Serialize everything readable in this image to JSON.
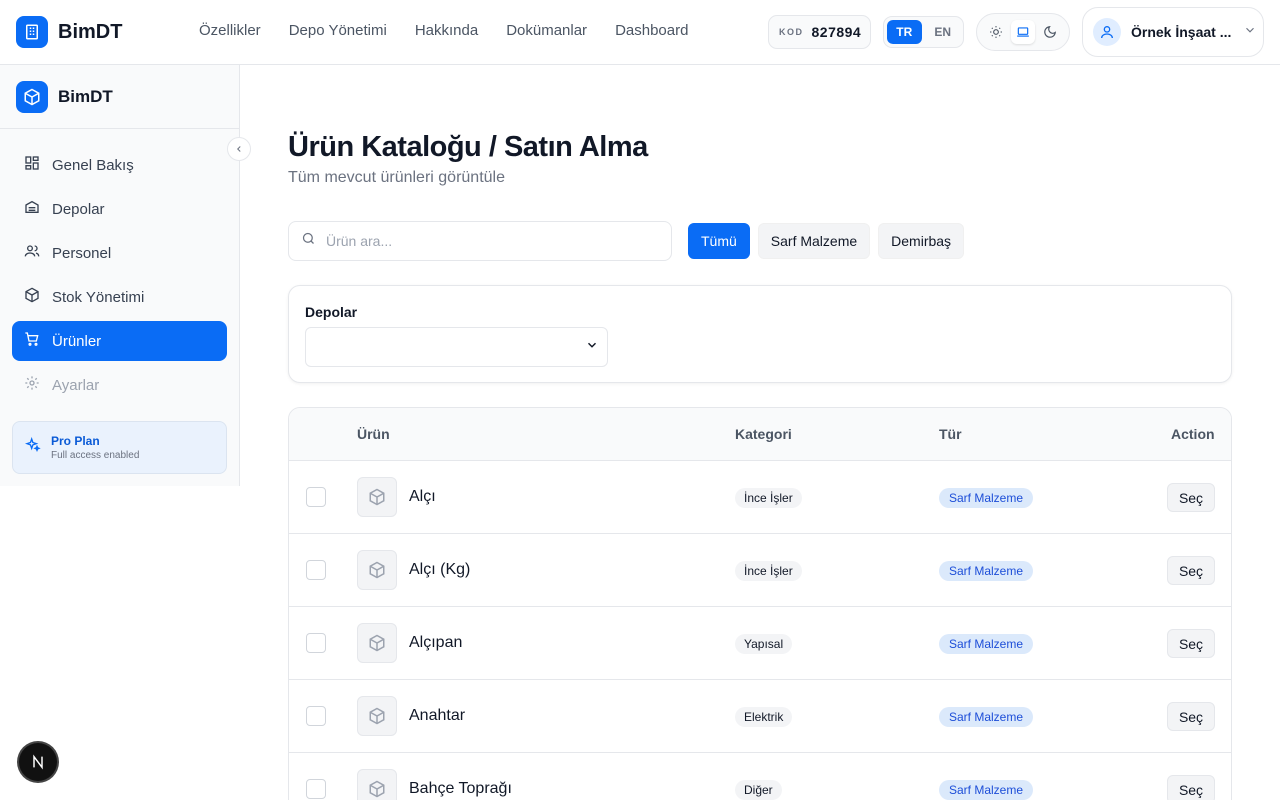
{
  "header": {
    "brand": "BimDT",
    "nav": [
      "Özellikler",
      "Depo Yönetimi",
      "Hakkında",
      "Dokümanlar",
      "Dashboard"
    ],
    "code_label": "KOD",
    "code_value": "827894",
    "lang": {
      "tr": "TR",
      "en": "EN",
      "active": "TR"
    },
    "theme_icons": [
      "sun-icon",
      "laptop-icon",
      "moon-icon"
    ],
    "user_name": "Örnek İnşaat ..."
  },
  "sidebar": {
    "brand": "BimDT",
    "items": [
      {
        "label": "Genel Bakış",
        "icon": "grid-icon"
      },
      {
        "label": "Depolar",
        "icon": "warehouse-icon"
      },
      {
        "label": "Personel",
        "icon": "users-icon"
      },
      {
        "label": "Stok Yönetimi",
        "icon": "box-icon"
      },
      {
        "label": "Ürünler",
        "icon": "cart-icon",
        "active": true
      },
      {
        "label": "Ayarlar",
        "icon": "gear-icon",
        "disabled": true
      }
    ],
    "pro_title": "Pro Plan",
    "pro_sub": "Full access enabled"
  },
  "main": {
    "title": "Ürün Kataloğu / Satın Alma",
    "subtitle": "Tüm mevcut ürünleri görüntüle",
    "search_placeholder": "Ürün ara...",
    "filters": [
      "Tümü",
      "Sarf Malzeme",
      "Demirbaş"
    ],
    "warehouse_label": "Depolar",
    "table": {
      "headers": {
        "product": "Ürün",
        "category": "Kategori",
        "type": "Tür",
        "action": "Action"
      },
      "action_label": "Seç",
      "rows": [
        {
          "name": "Alçı",
          "category": "İnce İşler",
          "type": "Sarf Malzeme"
        },
        {
          "name": "Alçı (Kg)",
          "category": "İnce İşler",
          "type": "Sarf Malzeme"
        },
        {
          "name": "Alçıpan",
          "category": "Yapısal",
          "type": "Sarf Malzeme"
        },
        {
          "name": "Anahtar",
          "category": "Elektrik",
          "type": "Sarf Malzeme"
        },
        {
          "name": "Bahçe Toprağı",
          "category": "Diğer",
          "type": "Sarf Malzeme"
        }
      ]
    }
  },
  "colors": {
    "accent": "#0a6cf5",
    "badge_type_bg": "#dbe9fb",
    "badge_type_text": "#1d4ed8"
  }
}
